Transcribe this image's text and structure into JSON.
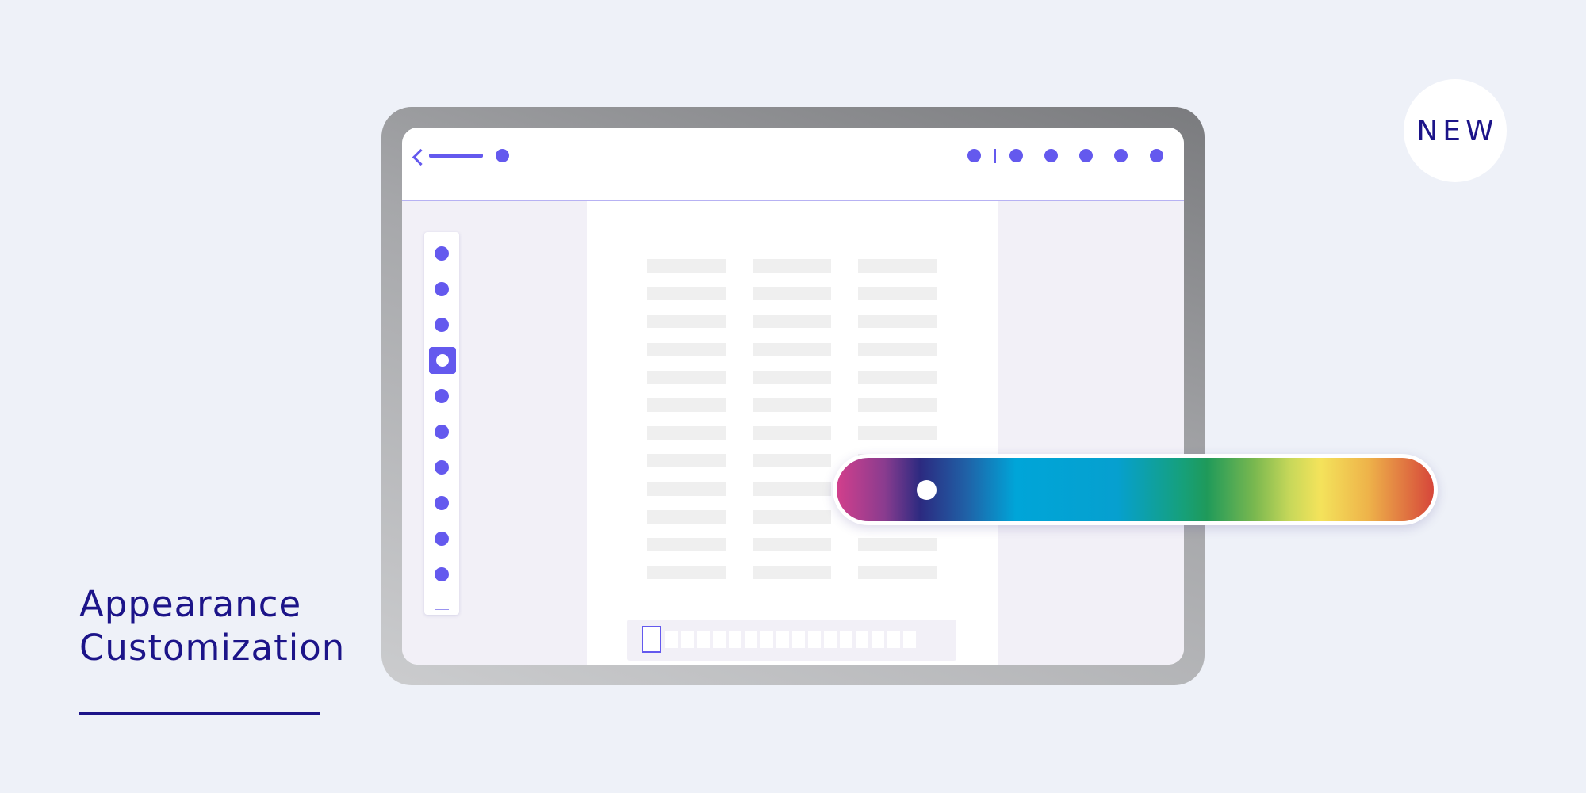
{
  "badge": {
    "label": "NEW"
  },
  "headline": {
    "line1": "Appearance",
    "line2": "Customization"
  },
  "colors": {
    "background": "#eef1f8",
    "accent": "#6459ee",
    "text": "#1c1489",
    "panel": "#f2f0f7",
    "placeholder": "#efefef"
  },
  "mockup": {
    "topbar": {
      "icons": [
        "back-chevron-icon",
        "title-placeholder",
        "status-dot-icon"
      ],
      "right_icons": [
        "toolbar-dot-icon",
        "divider",
        "toolbar-dot-icon",
        "toolbar-dot-icon",
        "toolbar-dot-icon",
        "toolbar-dot-icon",
        "toolbar-dot-icon"
      ]
    },
    "side_toolbar": {
      "tool_count": 10,
      "active_tool_index": 3,
      "menu_icon": "menu-lines-icon"
    },
    "content_grid": {
      "columns": 3,
      "rows": 12
    },
    "page_navigator": {
      "page_count": 17,
      "selected_page_index": 0
    }
  },
  "color_slider": {
    "gradient": [
      "#d23f8c",
      "#2c2a80",
      "#00a5d8",
      "#1f9a5a",
      "#f4e35b",
      "#d6463a"
    ],
    "value": 0.15
  }
}
